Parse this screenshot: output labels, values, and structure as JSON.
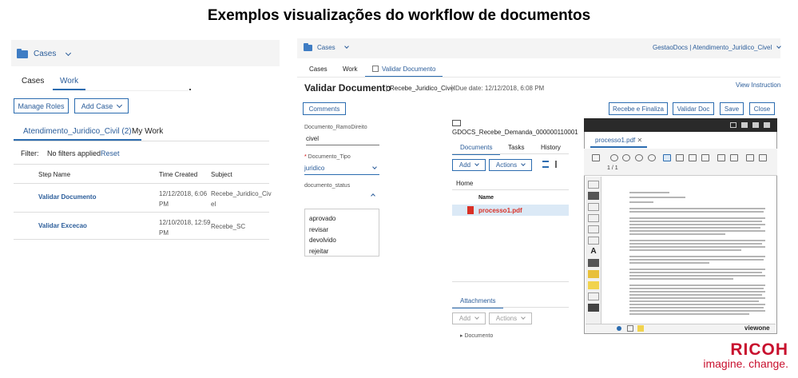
{
  "title": "Exemplos visualizações do workflow de documentos",
  "left": {
    "header_label": "Cases",
    "tabs": [
      "Cases",
      "Work"
    ],
    "manage_roles": "Manage Roles",
    "add_case": "Add Case",
    "subtabs": [
      "Atendimento_Juridico_Civil (2)",
      "My Work"
    ],
    "filter_label": "Filter:",
    "filter_value": "No filters applied",
    "reset": "Reset",
    "columns": [
      "Step Name",
      "Time Created",
      "Subject"
    ],
    "rows": [
      {
        "step": "Validar Documento",
        "time1": "12/12/2018, 6:06",
        "time2": "PM",
        "subj1": "Recebe_Juridico_Civ",
        "subj2": "el"
      },
      {
        "step": "Validar Excecao",
        "time1": "12/10/2018, 12:59",
        "time2": "PM",
        "subj1": "Recebe_SC",
        "subj2": ""
      }
    ]
  },
  "right": {
    "header_label": "Cases",
    "header_right": "GestaoDocs | Atendimento_Juridico_Civel",
    "tabs": [
      "Cases",
      "Work",
      "Validar Documento"
    ],
    "page_title": "Validar Documento",
    "page_meta": "Recebe_Juridico_Civel",
    "due": "Due date: 12/12/2018, 6:08 PM",
    "view_instructions": "View Instruction",
    "comments": "Comments",
    "actions": [
      "Recebe e Finaliza",
      "Validar Doc",
      "Save",
      "Close"
    ],
    "form": {
      "ramo_label": "Documento_RamoDireito",
      "ramo_value": "civel",
      "tipo_label": "Documento_Tipo",
      "tipo_value": "juridico",
      "status_label": "documento_status",
      "status_options": [
        "aprovado",
        "revisar",
        "devolvido",
        "rejeitar"
      ]
    },
    "folder_name": "GDOCS_Recebe_Demanda_000000110001",
    "doc_tabs": [
      "Documents",
      "Tasks",
      "History"
    ],
    "add": "Add",
    "doc_actions": "Actions",
    "home": "Home",
    "name_col": "Name",
    "file": "processo1.pdf",
    "attachments": "Attachments",
    "attach_item": "Documento",
    "viewer_tab": "processo1.pdf",
    "page_nav": "1 / 1",
    "viewer_brand": "viewone"
  },
  "ricoh": {
    "word": "RICOH",
    "tag": "imagine. change."
  }
}
